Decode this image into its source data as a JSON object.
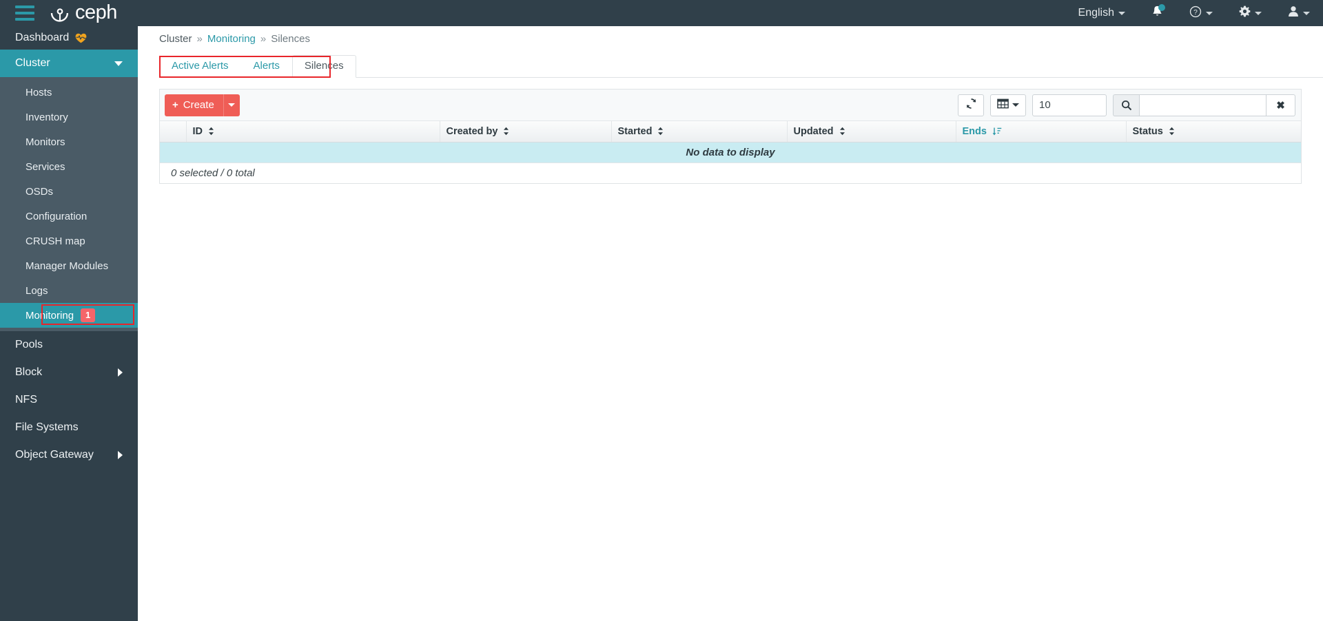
{
  "topbar": {
    "hamburger_icon": "hamburger-menu-icon",
    "brand": "ceph",
    "brand_icon": "ceph-logo-icon",
    "language": "English",
    "notifications_icon": "bell-icon",
    "help_icon": "question-circle-icon",
    "settings_icon": "gear-icon",
    "user_icon": "user-icon"
  },
  "sidebar": {
    "dashboard": {
      "label": "Dashboard",
      "icon": "heartbeat-icon"
    },
    "cluster": {
      "label": "Cluster",
      "expanded": true,
      "chevron": "chevron-down-icon"
    },
    "cluster_items": [
      {
        "label": "Hosts"
      },
      {
        "label": "Inventory"
      },
      {
        "label": "Monitors"
      },
      {
        "label": "Services"
      },
      {
        "label": "OSDs"
      },
      {
        "label": "Configuration"
      },
      {
        "label": "CRUSH map"
      },
      {
        "label": "Manager Modules"
      },
      {
        "label": "Logs"
      },
      {
        "label": "Monitoring",
        "badge": "1",
        "active": true,
        "highlighted": true
      }
    ],
    "bottom_items": [
      {
        "label": "Pools",
        "chevron": ""
      },
      {
        "label": "Block",
        "chevron": "chevron-right-icon"
      },
      {
        "label": "NFS",
        "chevron": ""
      },
      {
        "label": "File Systems",
        "chevron": ""
      },
      {
        "label": "Object Gateway",
        "chevron": "chevron-right-icon"
      }
    ]
  },
  "breadcrumb": {
    "root": "Cluster",
    "sep": "»",
    "middle": "Monitoring",
    "current": "Silences"
  },
  "tabs": [
    {
      "label": "Active Alerts",
      "active": false
    },
    {
      "label": "Alerts",
      "active": false
    },
    {
      "label": "Silences",
      "active": true
    }
  ],
  "toolbar": {
    "create_label": "Create",
    "create_plus": "+",
    "create_caret_icon": "caret-down-icon",
    "refresh_icon": "refresh-icon",
    "columns_icon": "table-columns-icon",
    "columns_caret_icon": "caret-down-icon",
    "limit_value": "10",
    "limit_spinner_icon": "spinner-up-down-icon",
    "search_icon": "magnifier-icon",
    "search_value": "",
    "search_placeholder": "",
    "clear_icon": "✖"
  },
  "table": {
    "columns": [
      {
        "label": "",
        "kind": "checkbox"
      },
      {
        "label": "ID",
        "sort": "unsorted"
      },
      {
        "label": "Created by",
        "sort": "unsorted"
      },
      {
        "label": "Started",
        "sort": "unsorted"
      },
      {
        "label": "Updated",
        "sort": "unsorted"
      },
      {
        "label": "Ends",
        "sort": "desc"
      },
      {
        "label": "Status",
        "sort": "unsorted"
      }
    ],
    "rows": [],
    "empty_message": "No data to display",
    "footer": "0 selected / 0 total"
  },
  "colors": {
    "navbar_bg": "#30404a",
    "submenu_bg": "#4a5b66",
    "accent_teal": "#2b99a8",
    "create_red": "#ef5d56",
    "badge_red": "#f4656a",
    "annotation_red": "#e8252a",
    "empty_row_cyan": "#c9ecf2",
    "heart_orange": "#f0a31e"
  }
}
